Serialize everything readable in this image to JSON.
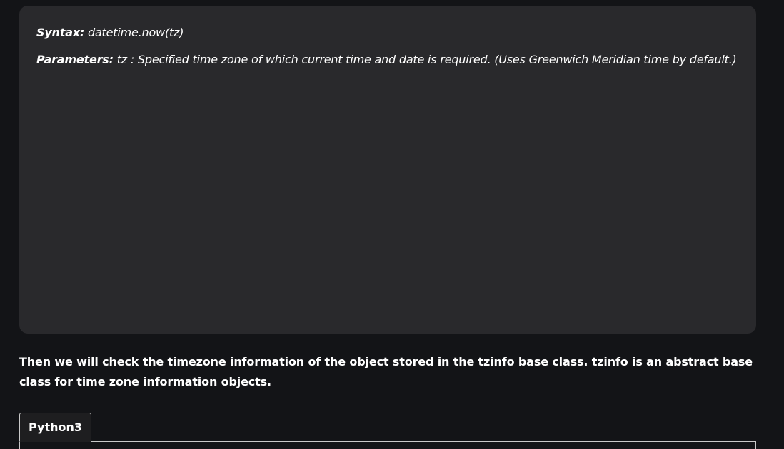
{
  "syntax": {
    "syntax_label": "Syntax:",
    "syntax_value": " datetime.now(tz)",
    "parameters_label": "Parameters:",
    "parameters_value": " tz : Specified time zone of which current time and date is required. (Uses Greenwich Meridian time by default.)"
  },
  "body": {
    "paragraph": "Then we will check the timezone information of the object stored in the tzinfo base class. tzinfo is an abstract base class for time zone information objects."
  },
  "code_tabs": {
    "tabs": [
      {
        "label": "Python3"
      }
    ]
  },
  "colors": {
    "page_background": "#131417",
    "syntax_box_background": "#29292c",
    "text": "#ffffff",
    "tab_border": "#c9c9c9"
  }
}
